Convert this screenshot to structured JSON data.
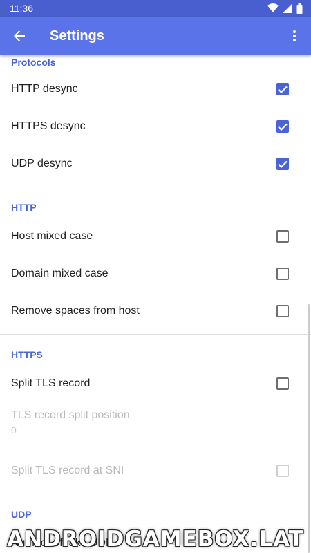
{
  "status_bar": {
    "time": "11:36"
  },
  "app_bar": {
    "title": "Settings"
  },
  "sections": {
    "protocols": {
      "header": "Protocols",
      "items": [
        {
          "title": "HTTP desync",
          "checked": true
        },
        {
          "title": "HTTPS desync",
          "checked": true
        },
        {
          "title": "UDP desync",
          "checked": true
        }
      ]
    },
    "http": {
      "header": "HTTP",
      "items": [
        {
          "title": "Host mixed case",
          "checked": false
        },
        {
          "title": "Domain mixed case",
          "checked": false
        },
        {
          "title": "Remove spaces from host",
          "checked": false
        }
      ]
    },
    "https": {
      "header": "HTTPS",
      "split_tls": {
        "title": "Split TLS record",
        "checked": false
      },
      "split_position": {
        "title": "TLS record split position",
        "summary": "0"
      },
      "split_at_sni": {
        "title": "Split TLS record at SNI",
        "checked": false,
        "enabled": false
      }
    },
    "udp": {
      "header": "UDP",
      "items": [
        {
          "title": "Number of fake UDP"
        }
      ]
    }
  },
  "watermark": "ANDROIDGAMEBOX.LAT",
  "colors": {
    "status_bar": "#4a5fcf",
    "app_bar": "#5b73e8",
    "accent": "#4a64d4"
  }
}
